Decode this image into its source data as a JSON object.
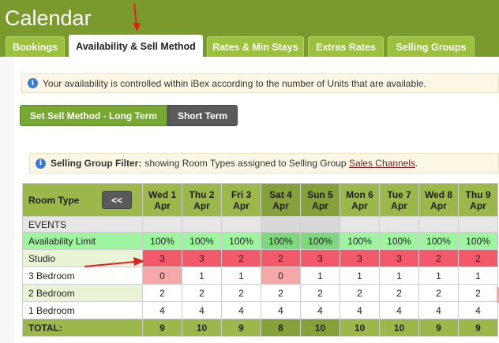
{
  "app": {
    "title": "Calendar"
  },
  "tabs": [
    {
      "label": "Bookings",
      "active": false
    },
    {
      "label": "Availability & Sell Method",
      "active": true
    },
    {
      "label": "Rates & Min Stays",
      "active": false
    },
    {
      "label": "Extras Rates",
      "active": false
    },
    {
      "label": "Selling Groups",
      "active": false
    }
  ],
  "info": {
    "icon": "info-icon",
    "text": "Your availability is controlled within iBex according to the number of Units that are available."
  },
  "sell_method": {
    "long_term_label": "Set Sell Method - Long Term",
    "short_term_label": "Short Term"
  },
  "filter": {
    "icon": "info-icon",
    "label": "Selling Group Filter:",
    "text": "showing Room Types assigned to Selling Group",
    "link": "Sales Channels",
    "suffix": "."
  },
  "grid": {
    "room_type_header": "Room Type",
    "back_button": "<<",
    "days": [
      {
        "dow": "Wed 1",
        "month": "Apr",
        "weekend": false
      },
      {
        "dow": "Thu 2",
        "month": "Apr",
        "weekend": false
      },
      {
        "dow": "Fri 3",
        "month": "Apr",
        "weekend": false
      },
      {
        "dow": "Sat 4",
        "month": "Apr",
        "weekend": true
      },
      {
        "dow": "Sun 5",
        "month": "Apr",
        "weekend": true
      },
      {
        "dow": "Mon 6",
        "month": "Apr",
        "weekend": false
      },
      {
        "dow": "Tue 7",
        "month": "Apr",
        "weekend": false
      },
      {
        "dow": "Wed 8",
        "month": "Apr",
        "weekend": false
      },
      {
        "dow": "Thu 9",
        "month": "Apr",
        "weekend": false
      }
    ],
    "rows": [
      {
        "label": "EVENTS",
        "kind": "events",
        "values": [
          "",
          "",
          "",
          "",
          "",
          "",
          "",
          "",
          ""
        ]
      },
      {
        "label": "Availability Limit",
        "kind": "avail",
        "values": [
          "100%",
          "100%",
          "100%",
          "100%",
          "100%",
          "100%",
          "100%",
          "100%",
          "100%"
        ]
      },
      {
        "label": "Studio",
        "kind": "studio",
        "values": [
          "3",
          "3",
          "2",
          "2",
          "3",
          "3",
          "3",
          "2",
          "2"
        ]
      },
      {
        "label": "3 Bedroom",
        "kind": "plain",
        "values": [
          "0",
          "1",
          "1",
          "0",
          "1",
          "1",
          "1",
          "1",
          "1"
        ]
      },
      {
        "label": "2 Bedroom",
        "kind": "alt",
        "values": [
          "2",
          "2",
          "2",
          "2",
          "2",
          "2",
          "2",
          "2",
          "2"
        ]
      },
      {
        "label": "1 Bedroom",
        "kind": "plain",
        "values": [
          "4",
          "4",
          "4",
          "4",
          "4",
          "4",
          "4",
          "4",
          "4"
        ]
      },
      {
        "label": "TOTAL:",
        "kind": "total",
        "values": [
          "9",
          "10",
          "9",
          "8",
          "10",
          "10",
          "10",
          "9",
          "9"
        ]
      }
    ]
  },
  "colors": {
    "header_green": "#7a9a2e",
    "tab_green": "#9cc13f",
    "studio_red": "#f25a6b",
    "avail_green": "#9ff59f",
    "zero_pink": "#f4a8a8",
    "annotation_arrow": "#e0201b"
  }
}
